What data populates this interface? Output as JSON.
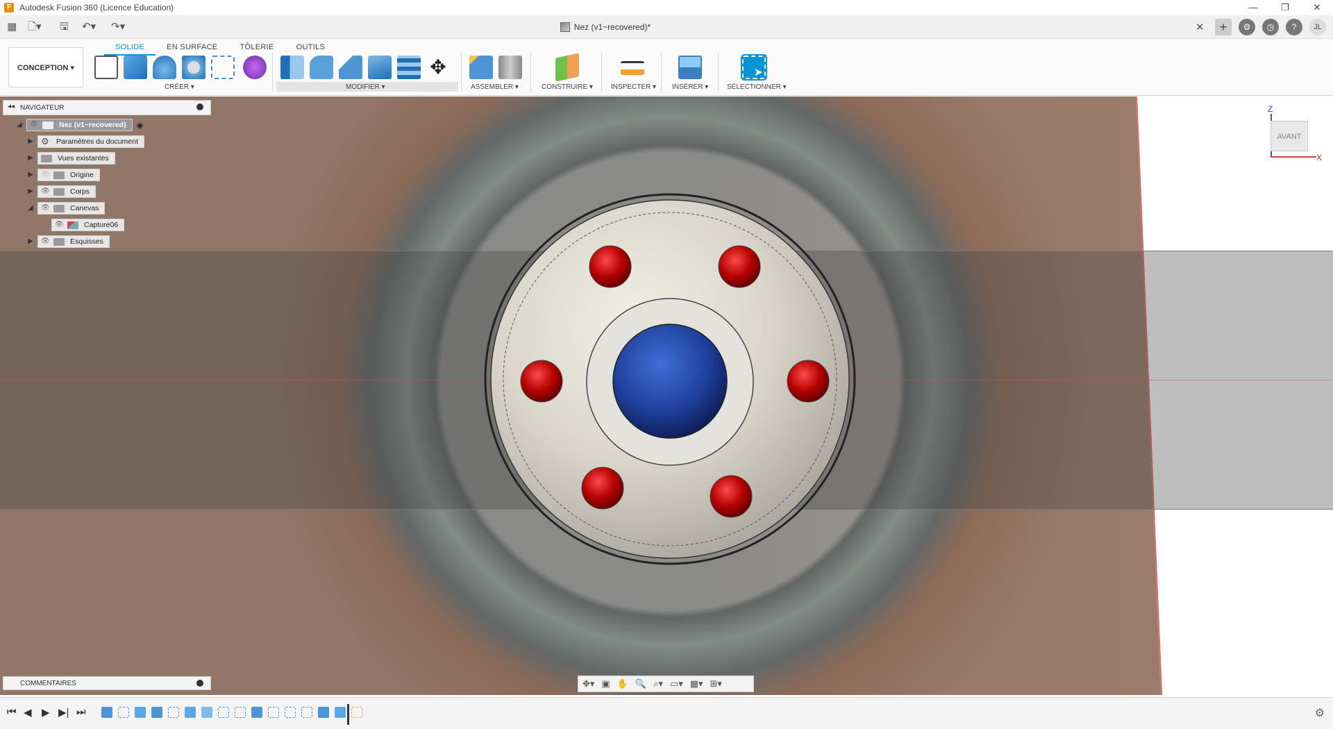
{
  "window": {
    "title": "Autodesk Fusion 360 (Licence Education)",
    "app_icon": "F",
    "controls": [
      "—",
      "❐",
      "✕"
    ]
  },
  "document": {
    "tab_title": "Nez (v1~recovered)*",
    "user_initials": "JL"
  },
  "ribbon": {
    "workspace": "CONCEPTION ▾",
    "tabs": [
      "SOLIDE",
      "EN SURFACE",
      "TÔLERIE",
      "OUTILS"
    ],
    "groups": {
      "creer": "CRÉER ▾",
      "modifier": "MODIFIER ▾",
      "assembler": "ASSEMBLER ▾",
      "construire": "CONSTRUIRE ▾",
      "inspecter": "INSPECTER ▾",
      "inserer": "INSÉRER ▾",
      "selectionner": "SÉLECTIONNER ▾"
    }
  },
  "navigator": {
    "label": "NAVIGATEUR",
    "root": "Nez (v1~recovered)",
    "items": [
      {
        "label": "Paramètres du document"
      },
      {
        "label": "Vues existantes"
      },
      {
        "label": "Origine"
      },
      {
        "label": "Corps"
      },
      {
        "label": "Canevas"
      },
      {
        "label": "Capture06"
      },
      {
        "label": "Esquisses"
      }
    ]
  },
  "viewcube": {
    "face": "AVANT",
    "z_label": "Z",
    "x_label": "X"
  },
  "comments": {
    "label": "COMMENTAIRES"
  },
  "colors": {
    "accent": "#0696d7",
    "hole_red": "#b50000",
    "center_blue": "#1f3f9a"
  }
}
